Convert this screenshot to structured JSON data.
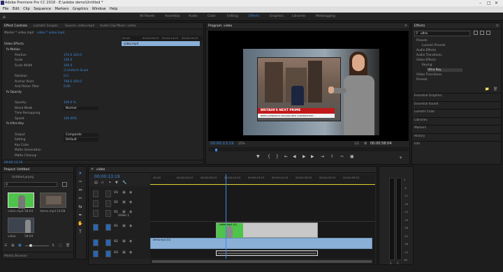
{
  "app": {
    "title": "Adobe Premiere Pro CC 2018 - E:\\adobe demo\\Untitled *",
    "menus": [
      "File",
      "Edit",
      "Clip",
      "Sequence",
      "Markers",
      "Graphics",
      "Window",
      "Help"
    ]
  },
  "workspaces": [
    "All Panels",
    "Assembly",
    "Audio",
    "Color",
    "Editing",
    "Effects",
    "Graphics",
    "Libraries",
    "Metalogging"
  ],
  "effect_controls": {
    "tabs": [
      "Effect Controls",
      "Lumetri Scopes",
      "Source: video.mp4",
      "Audio Clip Mixer: video"
    ],
    "source_master": "Master * video.mp4",
    "source_clip": "video * video.mp4",
    "ruler": [
      "00:00",
      "00:00:04:23",
      "00:00:09:23",
      "00:00:14:23",
      "00:00:19:23",
      "00:00:24:23"
    ],
    "clip_label": "video.mp4",
    "section": "Video Effects",
    "rows": [
      {
        "label": "fx  Motion",
        "value": ""
      },
      {
        "label": "Position",
        "value": "374.0    320.0"
      },
      {
        "label": "Scale",
        "value": "100.0"
      },
      {
        "label": "Scale Width",
        "value": "100.0"
      },
      {
        "label": "",
        "value": "☑ Uniform Scale"
      },
      {
        "label": "Rotation",
        "value": "0.0"
      },
      {
        "label": "Anchor Point",
        "value": "768.0    500.0"
      },
      {
        "label": "Anti-flicker Filter",
        "value": "0.00"
      },
      {
        "label": "fx  Opacity",
        "value": ""
      },
      {
        "label": "",
        "value": ""
      },
      {
        "label": "Opacity",
        "value": "100.0 %"
      },
      {
        "label": "Blend Mode",
        "value": "Normal"
      },
      {
        "label": "Time Remapping",
        "value": ""
      },
      {
        "label": "Speed",
        "value": "100.00%"
      },
      {
        "label": "fx  Ultra Key",
        "value": ""
      },
      {
        "label": "",
        "value": ""
      },
      {
        "label": "Output",
        "value": "Composite"
      },
      {
        "label": "Setting",
        "value": "Default"
      },
      {
        "label": "Key Color",
        "value": ""
      },
      {
        "label": "Matte Generation",
        "value": ""
      },
      {
        "label": "Matte Cleanup",
        "value": ""
      }
    ],
    "timecode": "00:00:13:19"
  },
  "program": {
    "title": "Program: video",
    "timecode": "00:00:13:19",
    "zoom": "25%",
    "quality": "1/2",
    "duration": "00:00:58:04",
    "headline": "BRITAIN'S NEXT PRIME",
    "subline": "BORIS JOHNSON IS WALKING NEW CONSERVATIVE..."
  },
  "effects_panel": {
    "title": "Effects",
    "search": "ultra",
    "tree": [
      "Presets",
      "Lumetri Presets",
      "Audio Effects",
      "Audio Transitions",
      "Video Effects",
      "Keying",
      "Ultra Key",
      "Video Transitions",
      "Presets"
    ],
    "panels": [
      "Essential Graphics",
      "Essential Sound",
      "Lumetri Color",
      "Libraries",
      "Markers",
      "History",
      "Info"
    ]
  },
  "project": {
    "title": "Project: Untitled",
    "file": "Untitled.prproj",
    "items": [
      {
        "name": "video.mp4",
        "dur": "58:04"
      },
      {
        "name": "demo.mp4",
        "dur": "10:08"
      },
      {
        "name": "video",
        "dur": "58:04"
      }
    ],
    "media_browser": "Media Browser"
  },
  "timeline": {
    "title": "video",
    "timecode": "00:00:13:19",
    "ruler": [
      "00:00",
      "00:00:04:23",
      "00:00:09:23",
      "00:00:14:23",
      "00:00:19:23",
      "00:00:24:23",
      "00:00:29:23",
      "00:00:34:23",
      "00:00:39:23"
    ],
    "tracks": [
      "V3",
      "V2",
      "V1",
      "A1",
      "A2",
      "A3"
    ],
    "v1_name": "Video 1",
    "clips": {
      "v2": "video.mp4 [V]",
      "v1": "demo.mp4 [V]"
    }
  },
  "meter_labels": [
    "0",
    "-6",
    "-12",
    "-18",
    "-24",
    "-30",
    "-36",
    "-42",
    "-48",
    "-54",
    "dB"
  ],
  "colors": {
    "accent": "#3d8ae0",
    "clip_green": "#5bd36a",
    "clip_blue": "#8ab0d8",
    "playhead": "#3d8ae0"
  }
}
